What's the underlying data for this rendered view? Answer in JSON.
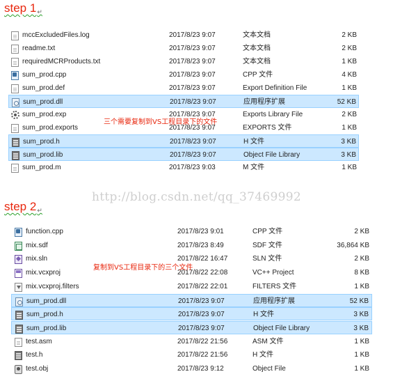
{
  "step1": {
    "title": "step 1",
    "mark": "↵",
    "note": "三个需要复制到VS工程目录下的文件",
    "files": [
      {
        "name": "mccExcludedFiles.log",
        "date": "2017/8/23 9:07",
        "type": "文本文档",
        "size": "2 KB",
        "icon": "text-doc-icon",
        "selected": false
      },
      {
        "name": "readme.txt",
        "date": "2017/8/23 9:07",
        "type": "文本文档",
        "size": "2 KB",
        "icon": "text-doc-icon",
        "selected": false
      },
      {
        "name": "requiredMCRProducts.txt",
        "date": "2017/8/23 9:07",
        "type": "文本文档",
        "size": "1 KB",
        "icon": "text-doc-icon",
        "selected": false
      },
      {
        "name": "sum_prod.cpp",
        "date": "2017/8/23 9:07",
        "type": "CPP 文件",
        "size": "4 KB",
        "icon": "cpp-file-icon",
        "selected": false
      },
      {
        "name": "sum_prod.def",
        "date": "2017/8/23 9:07",
        "type": "Export Definition File",
        "size": "1 KB",
        "icon": "def-file-icon",
        "selected": false
      },
      {
        "name": "sum_prod.dll",
        "date": "2017/8/23 9:07",
        "type": "应用程序扩展",
        "size": "52 KB",
        "icon": "dll-file-icon",
        "selected": true
      },
      {
        "name": "sum_prod.exp",
        "date": "2017/8/23 9:07",
        "type": "Exports Library File",
        "size": "2 KB",
        "icon": "gear-icon",
        "selected": false
      },
      {
        "name": "sum_prod.exports",
        "date": "2017/8/23 9:07",
        "type": "EXPORTS 文件",
        "size": "1 KB",
        "icon": "text-doc-icon",
        "selected": false
      },
      {
        "name": "sum_prod.h",
        "date": "2017/8/23 9:07",
        "type": "H 文件",
        "size": "3 KB",
        "icon": "header-file-icon",
        "selected": true
      },
      {
        "name": "sum_prod.lib",
        "date": "2017/8/23 9:07",
        "type": "Object File Library",
        "size": "3 KB",
        "icon": "lib-file-icon",
        "selected": true
      },
      {
        "name": "sum_prod.m",
        "date": "2017/8/23 9:03",
        "type": "M 文件",
        "size": "1 KB",
        "icon": "m-file-icon",
        "selected": false
      }
    ]
  },
  "watermark": "http://blog.csdn.net/qq_37469992",
  "step2": {
    "title": "step 2",
    "mark": "↵",
    "note": "复制到VS工程目录下的三个文件",
    "files": [
      {
        "name": "function.cpp",
        "date": "2017/8/23 9:01",
        "type": "CPP 文件",
        "size": "2 KB",
        "icon": "cpp-file-icon",
        "selected": false
      },
      {
        "name": "mix.sdf",
        "date": "2017/8/23 8:49",
        "type": "SDF 文件",
        "size": "36,864 KB",
        "icon": "database-file-icon",
        "selected": false
      },
      {
        "name": "mix.sln",
        "date": "2017/8/22 16:47",
        "type": "SLN 文件",
        "size": "2 KB",
        "icon": "solution-file-icon",
        "selected": false
      },
      {
        "name": "mix.vcxproj",
        "date": "2017/8/22 22:08",
        "type": "VC++ Project",
        "size": "8 KB",
        "icon": "vcxproj-file-icon",
        "selected": false
      },
      {
        "name": "mix.vcxproj.filters",
        "date": "2017/8/22 22:01",
        "type": "FILTERS 文件",
        "size": "1 KB",
        "icon": "filters-file-icon",
        "selected": false
      },
      {
        "name": "sum_prod.dll",
        "date": "2017/8/23 9:07",
        "type": "应用程序扩展",
        "size": "52 KB",
        "icon": "dll-file-icon",
        "selected": true
      },
      {
        "name": "sum_prod.h",
        "date": "2017/8/23 9:07",
        "type": "H 文件",
        "size": "3 KB",
        "icon": "header-file-icon",
        "selected": true
      },
      {
        "name": "sum_prod.lib",
        "date": "2017/8/23 9:07",
        "type": "Object File Library",
        "size": "3 KB",
        "icon": "lib-file-icon",
        "selected": true
      },
      {
        "name": "test.asm",
        "date": "2017/8/22 21:56",
        "type": "ASM 文件",
        "size": "1 KB",
        "icon": "text-doc-icon",
        "selected": false
      },
      {
        "name": "test.h",
        "date": "2017/8/22 21:56",
        "type": "H 文件",
        "size": "1 KB",
        "icon": "header-file-icon",
        "selected": false
      },
      {
        "name": "test.obj",
        "date": "2017/8/23 9:12",
        "type": "Object File",
        "size": "1 KB",
        "icon": "obj-file-icon",
        "selected": false
      }
    ]
  }
}
